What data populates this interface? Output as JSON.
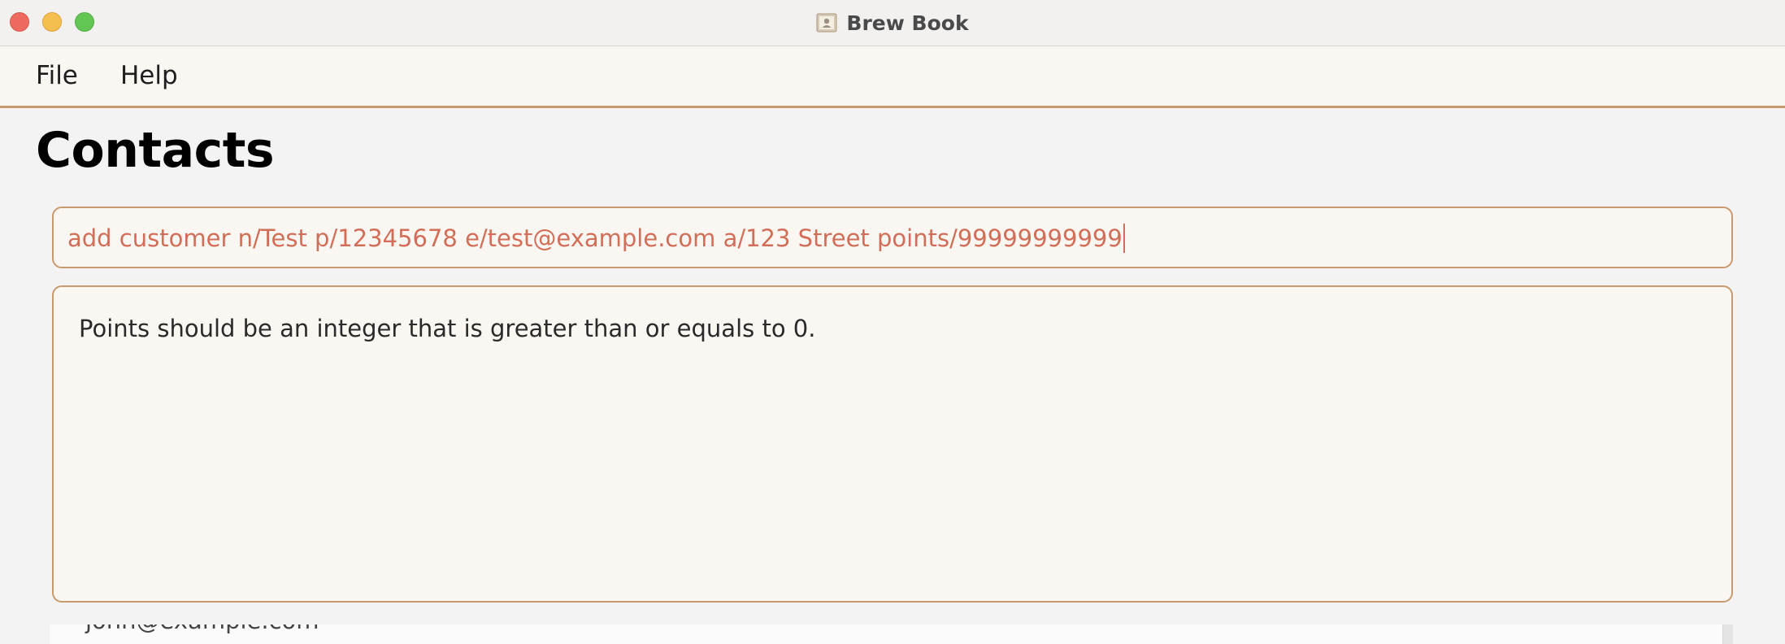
{
  "window": {
    "title": "Brew Book",
    "app_icon": "address-book-icon"
  },
  "menu": {
    "items": [
      {
        "label": "File"
      },
      {
        "label": "Help"
      }
    ]
  },
  "page": {
    "title": "Contacts"
  },
  "command_box": {
    "value": "add customer n/Test p/12345678 e/test@example.com a/123 Street points/99999999999",
    "text_color": "#d26e58"
  },
  "result": {
    "message": "Points should be an integer that is greater than or equals to 0."
  },
  "contact_list": {
    "visible_items": [
      {
        "email": "john@example.com"
      }
    ]
  },
  "colors": {
    "accent_border": "#c99a6e",
    "panel_background": "#faf7f2",
    "error_text": "#d26e58"
  }
}
